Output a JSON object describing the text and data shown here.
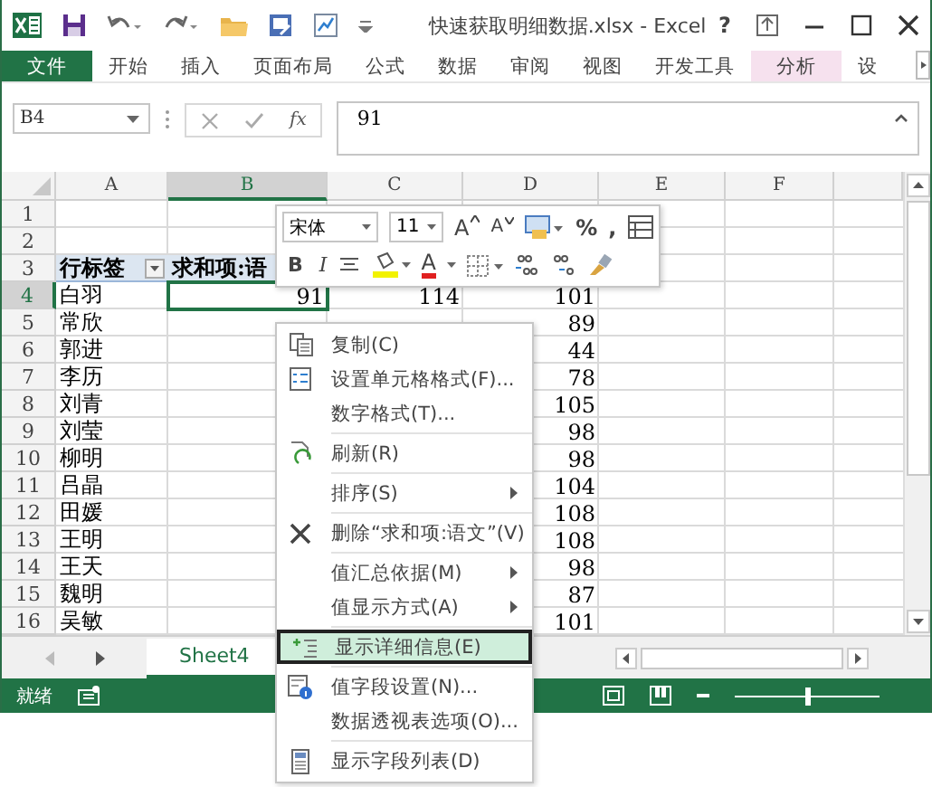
{
  "window": {
    "title": "快速获取明细数据.xlsx - Excel",
    "help": "?"
  },
  "ribbon_tabs": [
    {
      "label": "文件",
      "kind": "file"
    },
    {
      "label": "开始",
      "kind": "normal"
    },
    {
      "label": "插入",
      "kind": "normal"
    },
    {
      "label": "页面布局",
      "kind": "normal"
    },
    {
      "label": "公式",
      "kind": "normal"
    },
    {
      "label": "数据",
      "kind": "normal"
    },
    {
      "label": "审阅",
      "kind": "normal"
    },
    {
      "label": "视图",
      "kind": "normal"
    },
    {
      "label": "开发工具",
      "kind": "normal"
    },
    {
      "label": "分析",
      "kind": "contextual"
    },
    {
      "label": "设",
      "kind": "normal"
    }
  ],
  "formula_bar": {
    "name_box": "B4",
    "function_label": "fx",
    "value": "91"
  },
  "columns": [
    {
      "label": "A",
      "selected": false
    },
    {
      "label": "B",
      "selected": true
    },
    {
      "label": "C",
      "selected": false
    },
    {
      "label": "D",
      "selected": false
    },
    {
      "label": "E",
      "selected": false
    },
    {
      "label": "F",
      "selected": false
    }
  ],
  "rows": [
    {
      "num": "1",
      "selected": false,
      "kind": "blank"
    },
    {
      "num": "2",
      "selected": false,
      "kind": "blank"
    },
    {
      "num": "3",
      "selected": false,
      "kind": "header",
      "a": "行标签",
      "b": "求和项:语"
    },
    {
      "num": "4",
      "selected": true,
      "kind": "data",
      "a": "白羽",
      "b": "91",
      "c": "114",
      "d": "101"
    },
    {
      "num": "5",
      "selected": false,
      "kind": "data",
      "a": "常欣",
      "d": "89"
    },
    {
      "num": "6",
      "selected": false,
      "kind": "data",
      "a": "郭进",
      "d": "44"
    },
    {
      "num": "7",
      "selected": false,
      "kind": "data",
      "a": "李历",
      "d": "78"
    },
    {
      "num": "8",
      "selected": false,
      "kind": "data",
      "a": "刘青",
      "d": "105"
    },
    {
      "num": "9",
      "selected": false,
      "kind": "data",
      "a": "刘莹",
      "d": "98"
    },
    {
      "num": "10",
      "selected": false,
      "kind": "data",
      "a": "柳明",
      "d": "98"
    },
    {
      "num": "11",
      "selected": false,
      "kind": "data",
      "a": "吕晶",
      "d": "104"
    },
    {
      "num": "12",
      "selected": false,
      "kind": "data",
      "a": "田媛",
      "d": "108"
    },
    {
      "num": "13",
      "selected": false,
      "kind": "data",
      "a": "王明",
      "d": "108"
    },
    {
      "num": "14",
      "selected": false,
      "kind": "data",
      "a": "王天",
      "d": "98"
    },
    {
      "num": "15",
      "selected": false,
      "kind": "data",
      "a": "魏明",
      "d": "87"
    },
    {
      "num": "16",
      "selected": false,
      "kind": "data",
      "a": "吴敏",
      "d": "101"
    }
  ],
  "mini_toolbar": {
    "row_1": [
      {
        "kind": "font",
        "label": "宋体"
      },
      {
        "kind": "size",
        "label": "11"
      },
      {
        "kind": "grow",
        "label": "A"
      },
      {
        "kind": "shrink",
        "label": "A"
      },
      {
        "kind": "styles"
      },
      {
        "kind": "percent",
        "label": "%"
      },
      {
        "kind": "comma",
        "label": ","
      },
      {
        "kind": "table"
      }
    ],
    "row_2": [
      {
        "kind": "bold",
        "label": "B"
      },
      {
        "kind": "italic",
        "label": "I"
      },
      {
        "kind": "align"
      },
      {
        "kind": "fill"
      },
      {
        "kind": "fontcolor",
        "label": "A"
      },
      {
        "kind": "border"
      },
      {
        "kind": "incdec"
      },
      {
        "kind": "decdec"
      },
      {
        "kind": "painter"
      }
    ]
  },
  "context_menu": [
    {
      "kind": "copy",
      "label": "复制(C)",
      "selected": false
    },
    {
      "kind": "format",
      "label": "设置单元格格式(F)...",
      "selected": false
    },
    {
      "kind": "plain",
      "label": "数字格式(T)...",
      "selected": false
    },
    {
      "kind": "separator"
    },
    {
      "kind": "refresh",
      "label": "刷新(R)",
      "selected": false
    },
    {
      "kind": "separator"
    },
    {
      "kind": "submenu",
      "label": "排序(S)",
      "selected": false
    },
    {
      "kind": "separator"
    },
    {
      "kind": "delete",
      "label": "删除“求和项:语文”(V)",
      "selected": false
    },
    {
      "kind": "separator"
    },
    {
      "kind": "submenu",
      "label": "值汇总依据(M)",
      "selected": false
    },
    {
      "kind": "submenu",
      "label": "值显示方式(A)",
      "selected": false
    },
    {
      "kind": "separator"
    },
    {
      "kind": "detail",
      "label": "显示详细信息(E)",
      "selected": true
    },
    {
      "kind": "separator"
    },
    {
      "kind": "settings",
      "label": "值字段设置(N)...",
      "selected": false
    },
    {
      "kind": "plain",
      "label": "数据透视表选项(O)...",
      "selected": false
    },
    {
      "kind": "separator"
    },
    {
      "kind": "list",
      "label": "显示字段列表(D)",
      "selected": false
    }
  ],
  "sheet_tabs": [
    {
      "label": "Sheet4",
      "selected": true
    }
  ],
  "status_bar": {
    "text": "就绪",
    "zoom": {
      "level": 0.5
    }
  }
}
